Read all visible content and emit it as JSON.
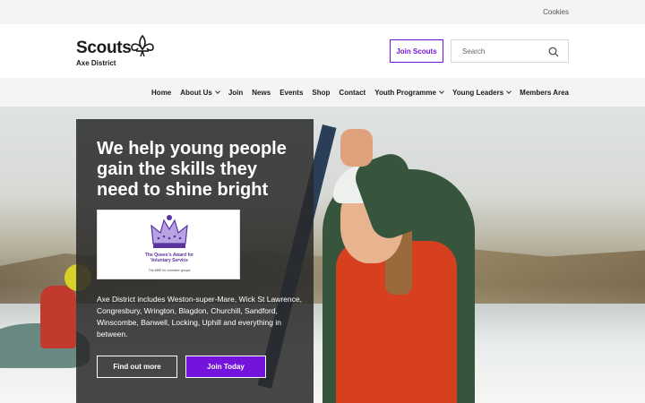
{
  "topbar": {
    "cookies_label": "Cookies"
  },
  "header": {
    "logo_word": "Scouts",
    "logo_district": "Axe District",
    "join_label": "Join Scouts",
    "search_placeholder": "Search"
  },
  "nav": {
    "items": [
      {
        "label": "Home",
        "dropdown": false
      },
      {
        "label": "About Us",
        "dropdown": true
      },
      {
        "label": "Join",
        "dropdown": false
      },
      {
        "label": "News",
        "dropdown": false
      },
      {
        "label": "Events",
        "dropdown": false
      },
      {
        "label": "Shop",
        "dropdown": false
      },
      {
        "label": "Contact",
        "dropdown": false
      },
      {
        "label": "Youth Programme",
        "dropdown": true
      },
      {
        "label": "Young Leaders",
        "dropdown": true
      },
      {
        "label": "Members Area",
        "dropdown": false
      }
    ]
  },
  "hero": {
    "heading": "We help young people gain the skills they need to shine bright",
    "award_title": "The Queen's Award for Voluntary Service",
    "award_subtitle": "The MBE for volunteer groups",
    "description": "Axe District includes Weston-super-Mare, Wick St Lawrence, Congresbury, Wrington, Blagdon, Churchill, Sandford, Winscombe, Banwell, Locking, Uphill and everything in between.",
    "find_out_label": "Find out more",
    "join_today_label": "Join Today"
  },
  "colors": {
    "accent": "#7413dc",
    "card_bg": "#282828",
    "nav_bg": "#f4f4f4"
  },
  "icons": [
    "fleur-de-lis-icon",
    "search-icon",
    "chevron-down-icon",
    "crown-icon"
  ]
}
